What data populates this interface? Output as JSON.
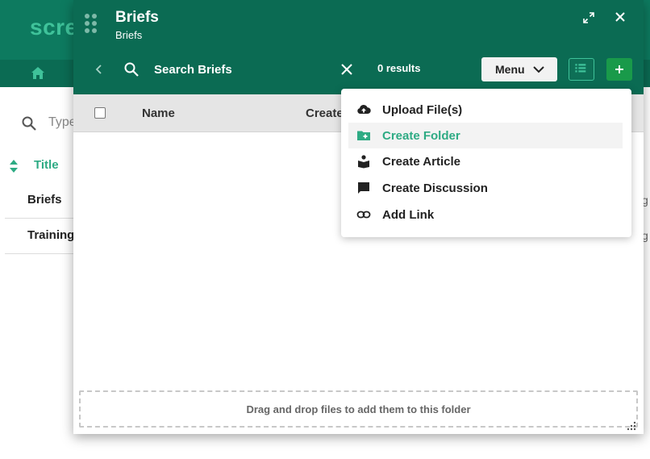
{
  "background": {
    "logo": "scre",
    "search_placeholder": "Type",
    "title_column": "Title",
    "rows": [
      "Briefs",
      "Training"
    ],
    "right_clip": [
      "g",
      "g"
    ]
  },
  "dialog": {
    "title": "Briefs",
    "subtitle": "Briefs",
    "search_placeholder": "Search Briefs",
    "results": "0 results",
    "menu_label": "Menu",
    "columns": {
      "name": "Name",
      "created": "Create"
    },
    "dropzone": "Drag and drop files to add them to this folder"
  },
  "menu_items": [
    {
      "label": "Upload File(s)",
      "icon": "cloud-upload-icon"
    },
    {
      "label": "Create Folder",
      "icon": "folder-plus-icon"
    },
    {
      "label": "Create Article",
      "icon": "article-reader-icon"
    },
    {
      "label": "Create Discussion",
      "icon": "chat-bubble-icon"
    },
    {
      "label": "Add Link",
      "icon": "link-icon"
    }
  ],
  "colors": {
    "header": "#0b6b53",
    "accent": "#2eab84",
    "add_button": "#199a4a"
  }
}
